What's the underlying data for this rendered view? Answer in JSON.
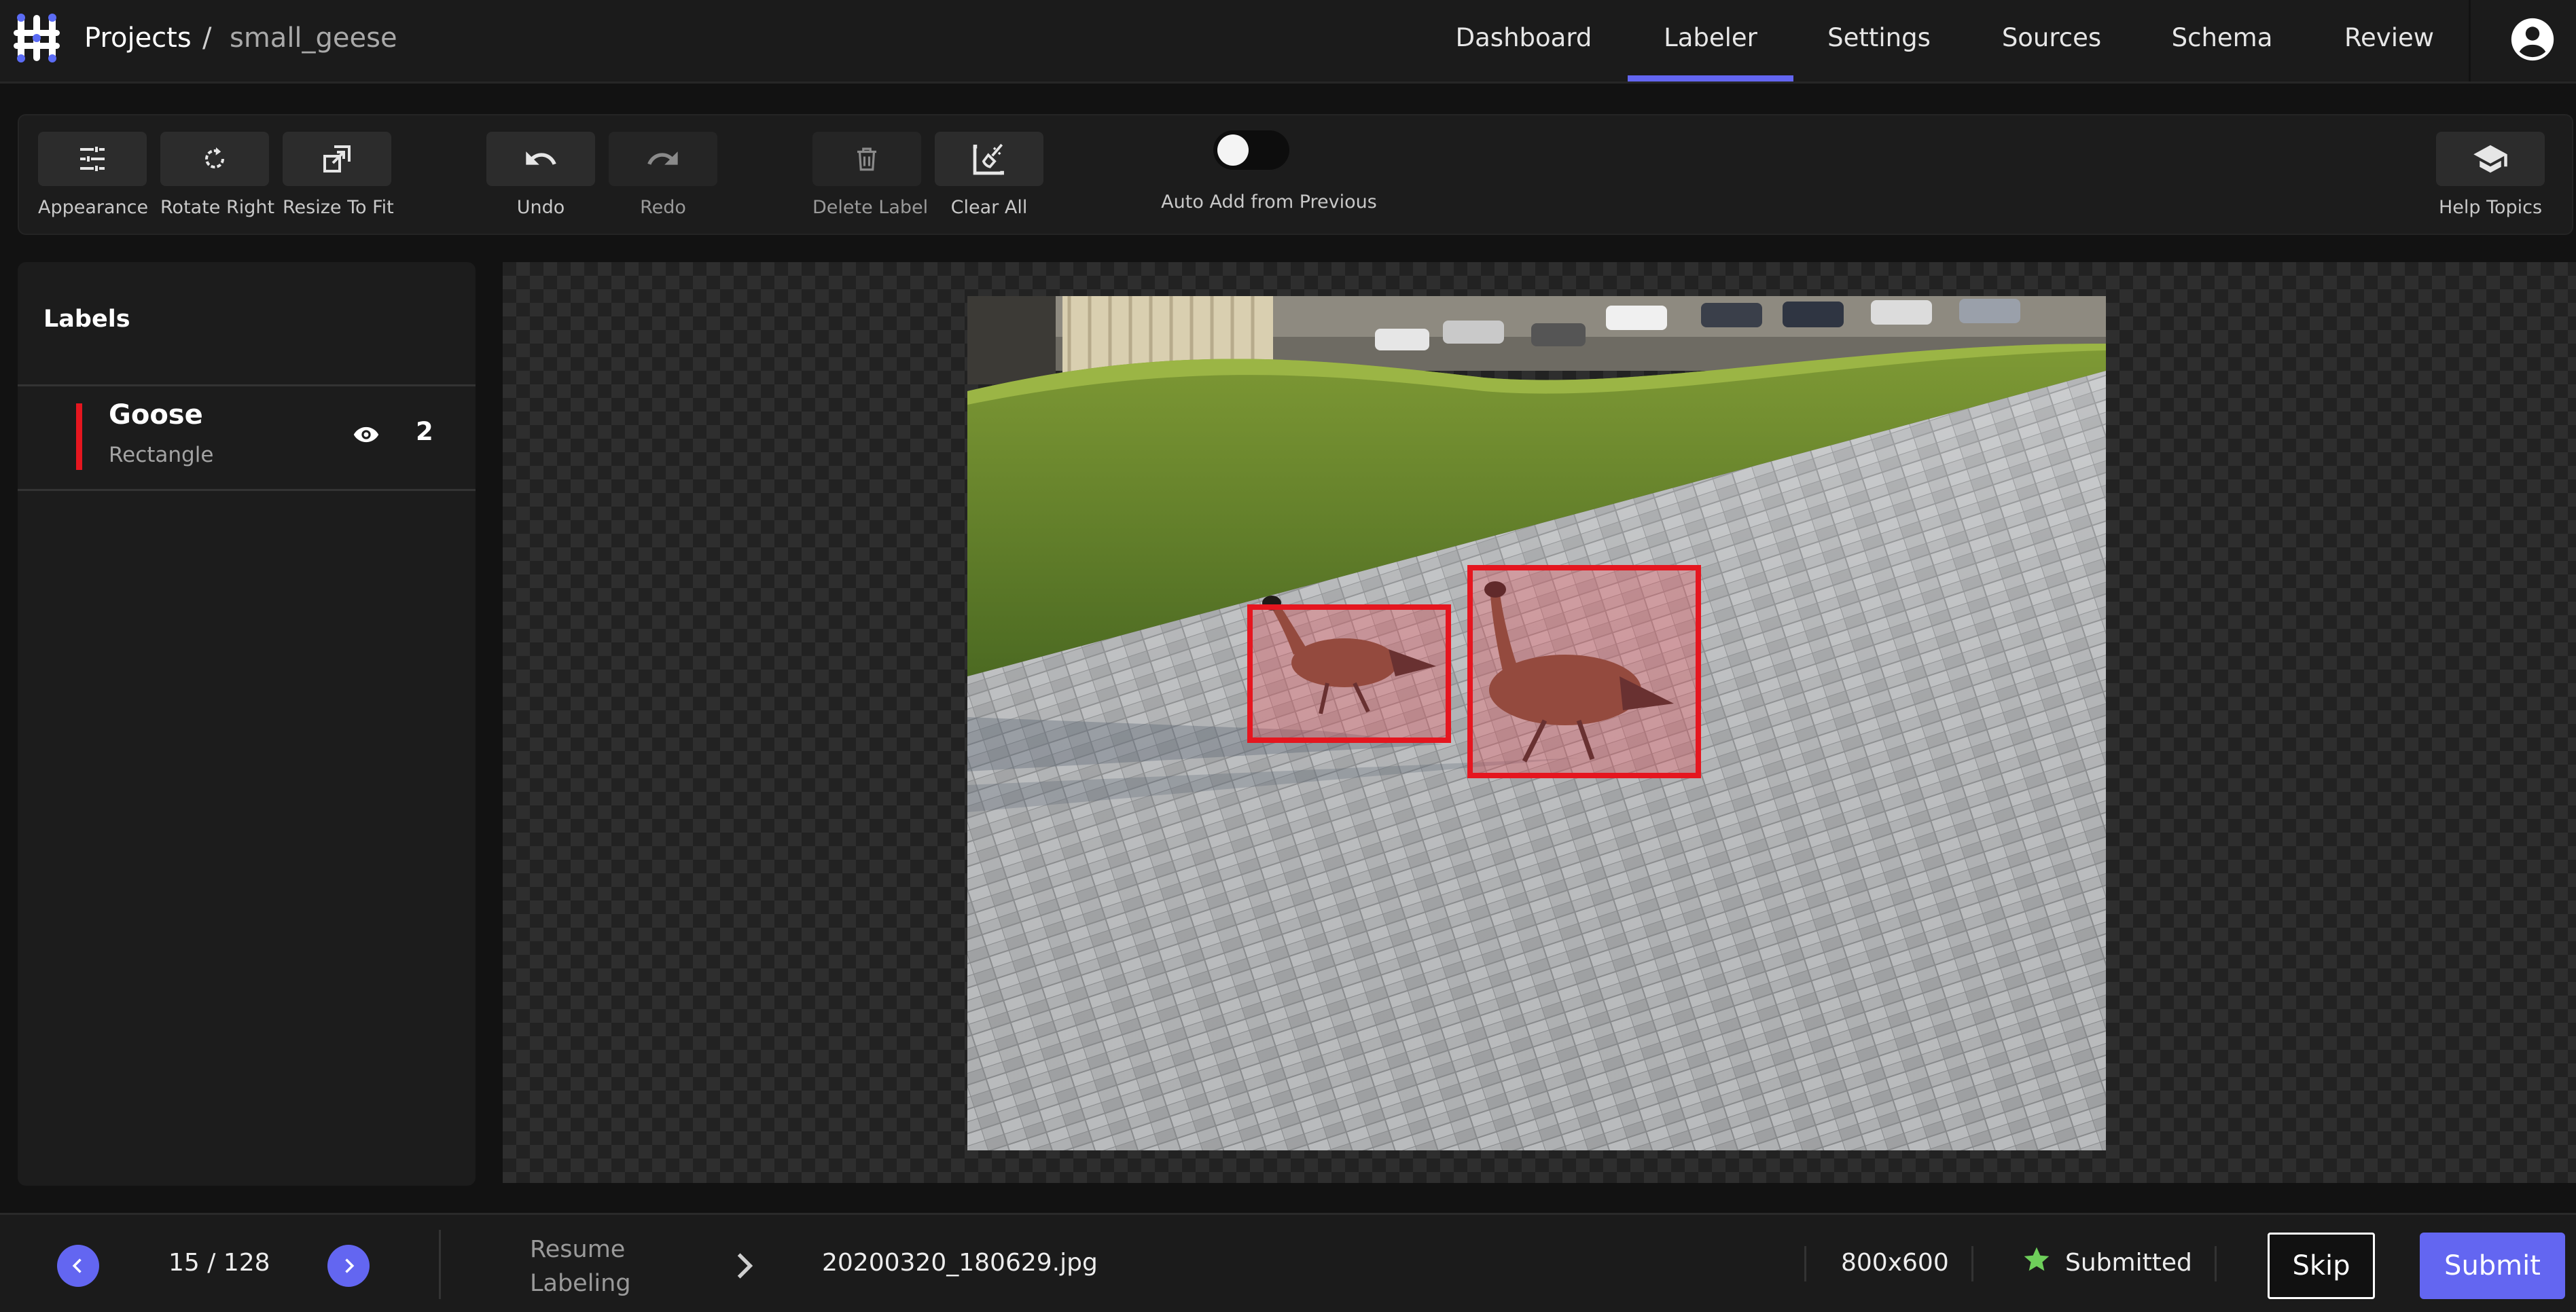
{
  "header": {
    "breadcrumb": {
      "projects": "Projects",
      "separator": "/",
      "project": "small_geese"
    },
    "tabs": [
      {
        "label": "Dashboard",
        "active": false
      },
      {
        "label": "Labeler",
        "active": true
      },
      {
        "label": "Settings",
        "active": false
      },
      {
        "label": "Sources",
        "active": false
      },
      {
        "label": "Schema",
        "active": false
      },
      {
        "label": "Review",
        "active": false
      }
    ],
    "user_icon": "account-circle-icon",
    "accent": "#6366f1"
  },
  "toolbar": {
    "appearance": {
      "label": "Appearance",
      "icon": "sliders-icon"
    },
    "rotate_right": {
      "label": "Rotate Right",
      "icon": "rotate-right-icon"
    },
    "resize_to_fit": {
      "label": "Resize To Fit",
      "icon": "resize-icon"
    },
    "undo": {
      "label": "Undo",
      "icon": "undo-icon",
      "enabled": true
    },
    "redo": {
      "label": "Redo",
      "icon": "redo-icon",
      "enabled": false
    },
    "delete_label": {
      "label": "Delete Label",
      "icon": "trash-icon",
      "enabled": false
    },
    "clear_all": {
      "label": "Clear All",
      "icon": "clear-all-icon"
    },
    "auto_add": {
      "label": "Auto Add from Previous",
      "on": false
    },
    "help": {
      "label": "Help Topics",
      "icon": "graduation-cap-icon"
    }
  },
  "labels_panel": {
    "title": "Labels",
    "items": [
      {
        "name": "Goose",
        "type": "Rectangle",
        "count": "2",
        "color": "#e5161f",
        "visible": true,
        "icon": "eye-icon"
      }
    ]
  },
  "canvas": {
    "image": "20200320_180629.jpg",
    "annotations": [
      {
        "label": "Goose",
        "color": "#e5161f"
      },
      {
        "label": "Goose",
        "color": "#e5161f"
      }
    ]
  },
  "footer": {
    "pagination": "15 / 128",
    "prev_icon": "chevron-left-icon",
    "next_icon": "chevron-right-icon",
    "resume_line1": "Resume",
    "resume_line2": "Labeling",
    "filename": "20200320_180629.jpg",
    "dimensions": "800x600",
    "status": "Submitted",
    "status_color": "#6ecf5a",
    "skip_label": "Skip",
    "submit_label": "Submit"
  }
}
